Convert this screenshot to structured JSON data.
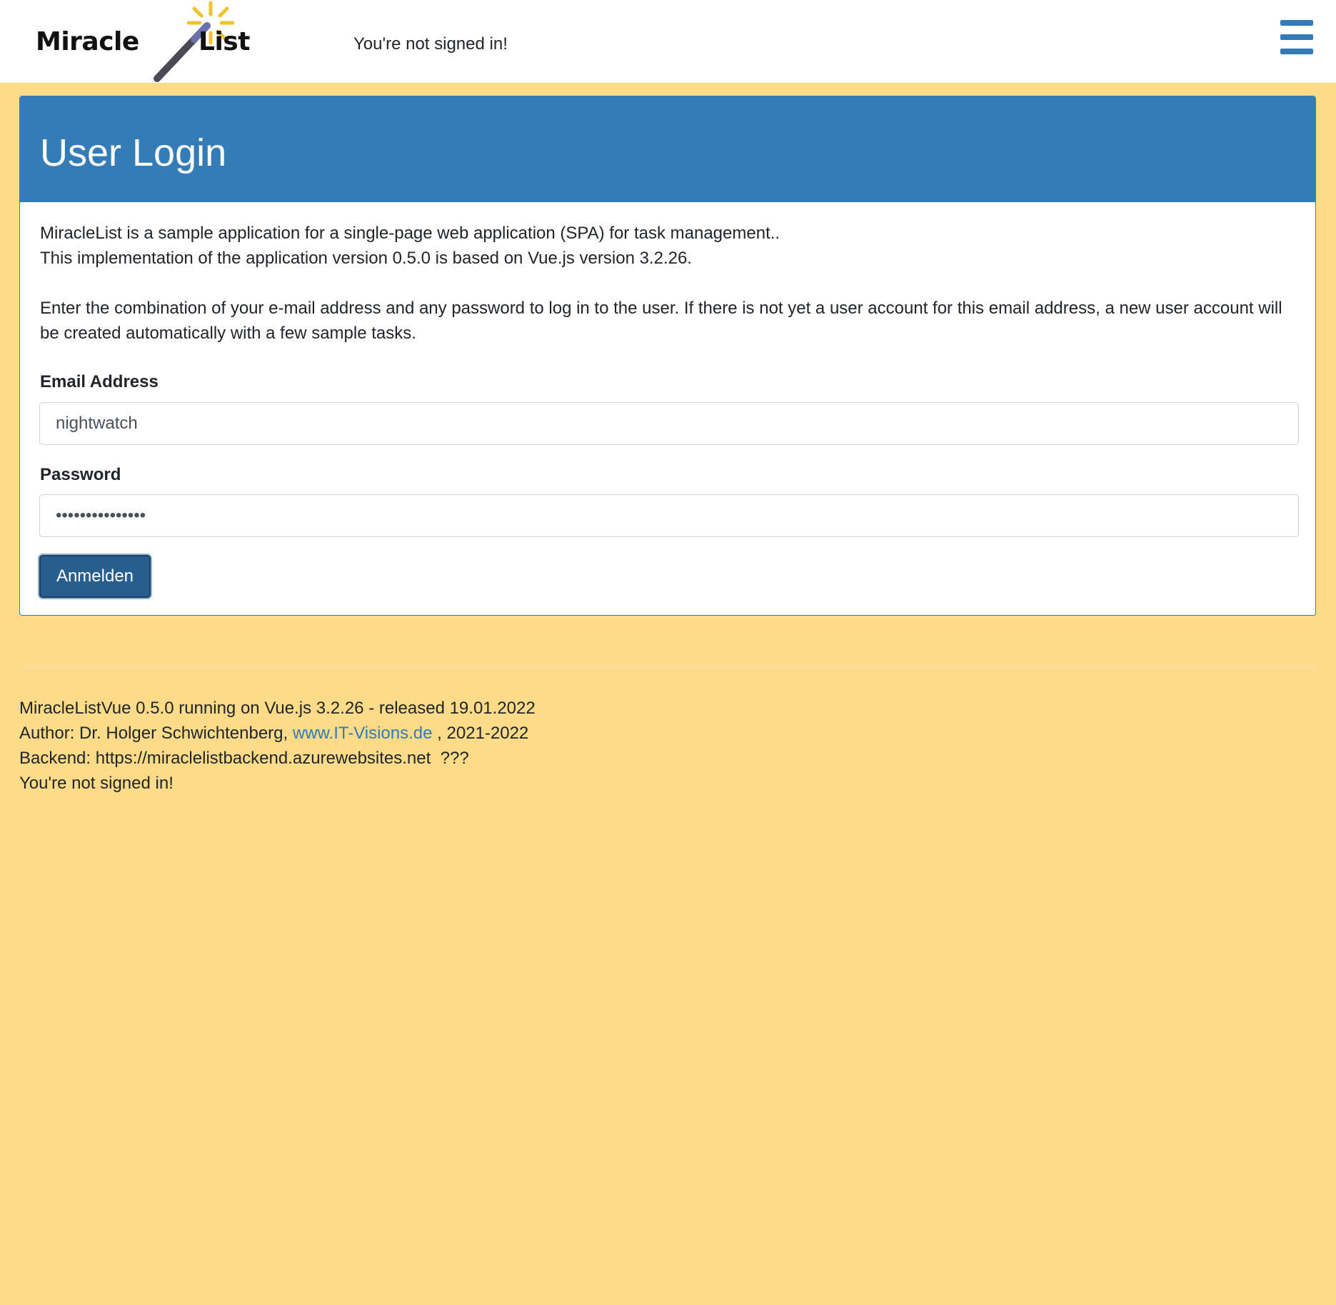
{
  "header": {
    "logo": {
      "word_left": "Miracle",
      "word_right": "List"
    },
    "status": "You're not signed in!",
    "menu_icon": "hamburger-menu-icon"
  },
  "login": {
    "title": "User Login",
    "intro_line1": "MiracleList is a sample application for a single-page web application (SPA) for task management..",
    "intro_line2": "This implementation of the application version 0.5.0 is based on Vue.js version 3.2.26.",
    "intro_para2": "Enter the combination of your e-mail address and any password to log in to the user. If there is not yet a user account for this email address, a new user account will be created automatically with a few sample tasks.",
    "email_label": "Email Address",
    "email_value": "nightwatch",
    "password_label": "Password",
    "password_value": "•••••••••••••••",
    "submit_label": "Anmelden"
  },
  "footer": {
    "version_line": "MiracleListVue 0.5.0 running on Vue.js 3.2.26 - released 19.01.2022",
    "author_prefix": "Author: Dr. Holger Schwichtenberg, ",
    "author_link": "www.IT-Visions.de",
    "author_suffix": " , 2021-2022",
    "backend_line": "Backend: https://miraclelistbackend.azurewebsites.net  ???",
    "status_line": "You're not signed in!"
  },
  "colors": {
    "page_background": "#fddb89",
    "brand_blue": "#337ab7",
    "button_blue": "#285e8e",
    "wand_yellow": "#f2c12e",
    "wand_purple": "#6a6fae"
  }
}
